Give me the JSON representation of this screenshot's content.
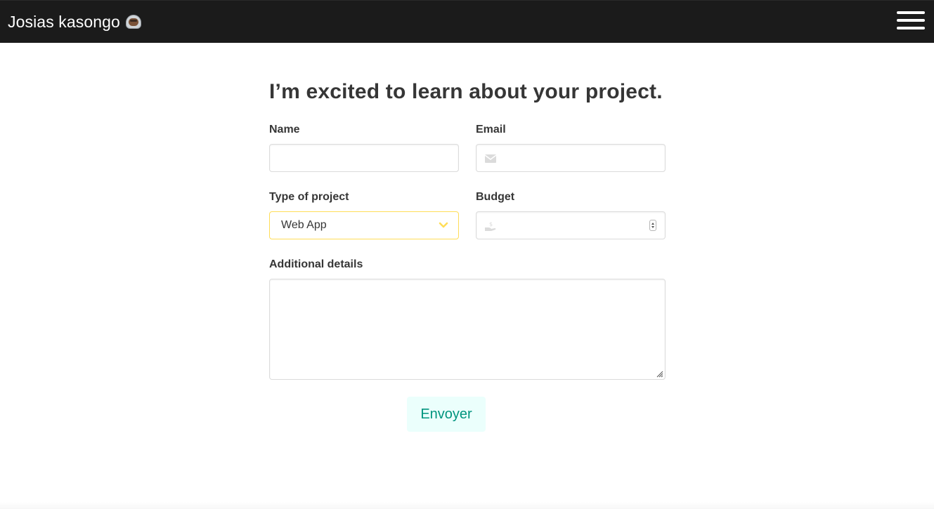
{
  "navbar": {
    "brand": "Josias kasongo",
    "brand_emoji_icon": "astronaut-emoji-icon",
    "menu_icon": "hamburger-menu-icon",
    "background": "#1b1b1b"
  },
  "form": {
    "heading": "I’m excited to learn about your project.",
    "name": {
      "label": "Name",
      "value": ""
    },
    "email": {
      "label": "Email",
      "value": "",
      "icon": "envelope-icon"
    },
    "project_type": {
      "label": "Type of project",
      "selected": "Web App",
      "icon": "chevron-down-icon",
      "accent": "#ffdd57"
    },
    "budget": {
      "label": "Budget",
      "value": "",
      "icon": "money-hand-icon"
    },
    "details": {
      "label": "Additional details",
      "value": ""
    },
    "submit_label": "Envoyer",
    "submit_colors": {
      "background": "#ebfffc",
      "text": "#00947e"
    }
  }
}
